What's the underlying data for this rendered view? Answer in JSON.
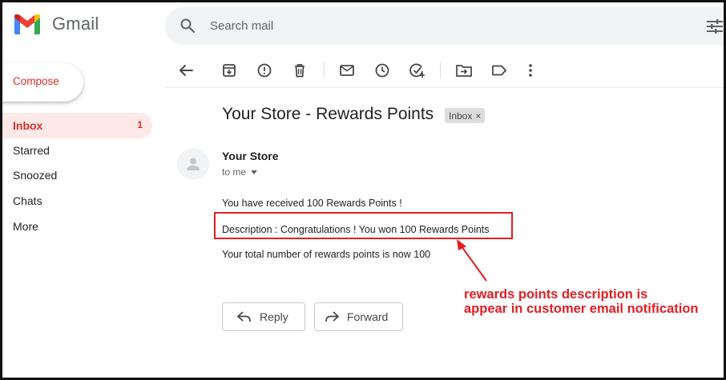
{
  "app": {
    "name": "Gmail"
  },
  "search": {
    "placeholder": "Search mail"
  },
  "sidebar": {
    "compose_label": "Compose",
    "items": [
      {
        "label": "Inbox",
        "count": "1",
        "active": true
      },
      {
        "label": "Starred"
      },
      {
        "label": "Snoozed"
      },
      {
        "label": "Chats"
      },
      {
        "label": "More"
      }
    ]
  },
  "toolbar": {
    "icons": [
      "back-arrow-icon",
      "archive-icon",
      "report-spam-icon",
      "delete-icon",
      "mark-unread-icon",
      "snooze-icon",
      "add-to-tasks-icon",
      "move-to-icon",
      "labels-icon",
      "more-vert-icon"
    ]
  },
  "message": {
    "subject": "Your Store - Rewards Points",
    "label_chip": "Inbox",
    "chip_close": "×",
    "sender": "Your Store",
    "to": "to me",
    "lines": [
      "You have received 100 Rewards Points !",
      "Description : Congratulations ! You won 100 Rewards Points",
      "Your total number of rewards points is now 100"
    ]
  },
  "actions": {
    "reply_label": "Reply",
    "forward_label": "Forward"
  },
  "annotation": {
    "line1": "rewards points description is",
    "line2": "appear in customer email notification",
    "color": "#e31e24"
  },
  "colors": {
    "accent": "#d93025",
    "active_bg": "#fce8e6",
    "search_bg": "#f1f3f4"
  }
}
